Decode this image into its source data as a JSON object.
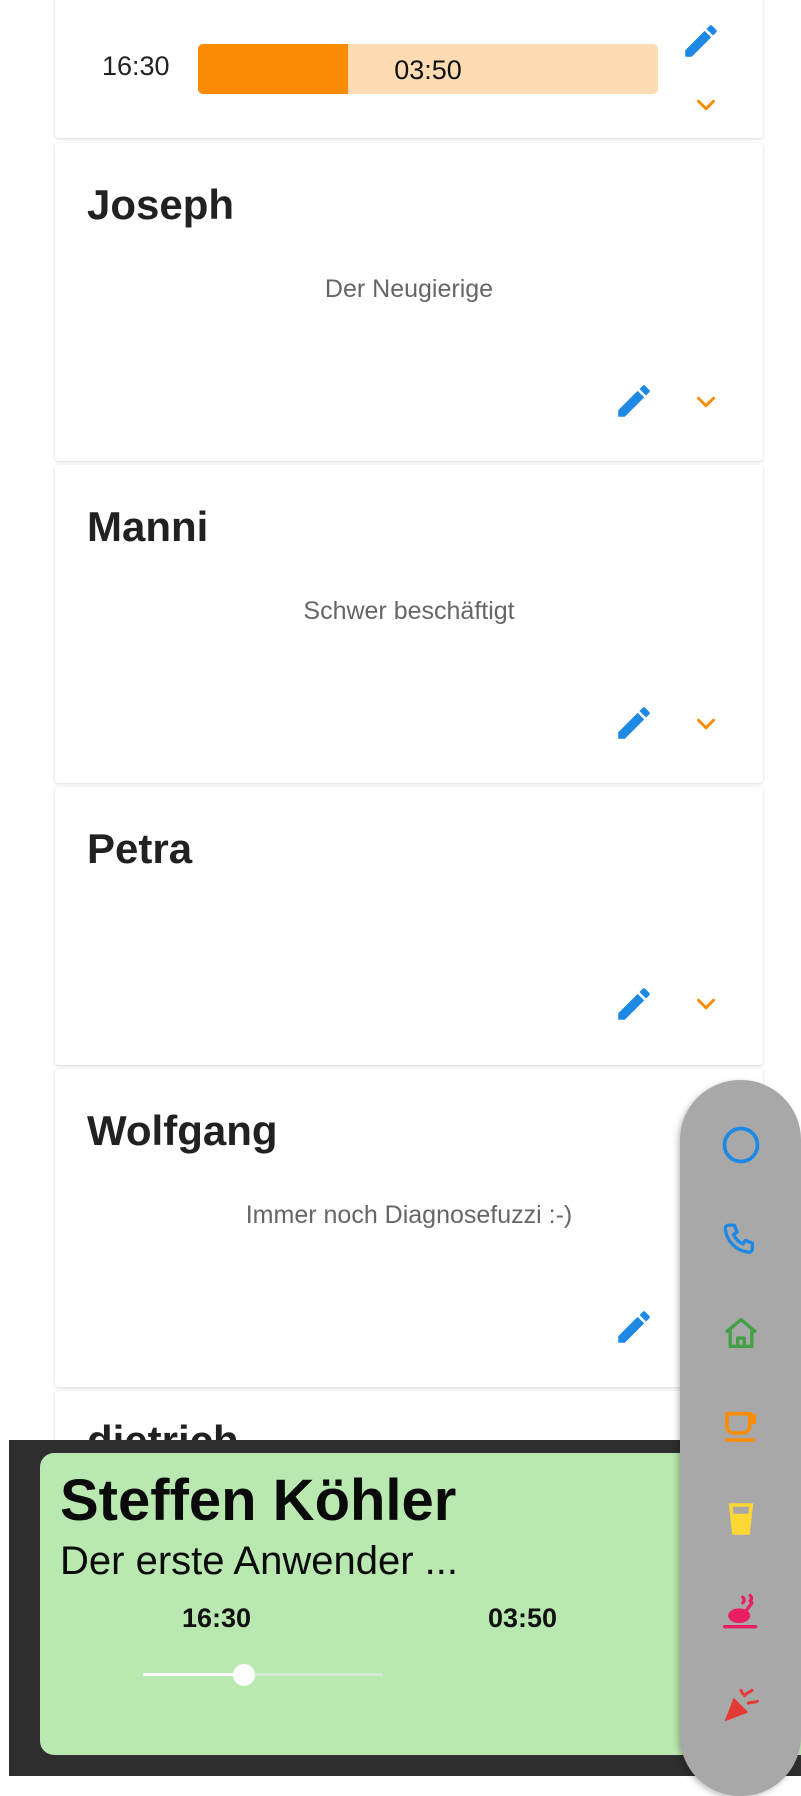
{
  "top_card": {
    "time_left": "16:30",
    "bar_text": "03:50",
    "progress": 0.325
  },
  "cards": [
    {
      "name": "Joseph",
      "status": "Der Neugierige"
    },
    {
      "name": "Manni",
      "status": "Schwer beschäftigt"
    },
    {
      "name": "Petra",
      "status": ""
    },
    {
      "name": "Wolfgang",
      "status": "Immer noch Diagnosefuzzi :-)"
    },
    {
      "name": "dietrich..."
    }
  ],
  "player": {
    "name": "Steffen Köhler",
    "description": "Der erste Anwender ...",
    "time_left": "16:30",
    "time_right": "03:50",
    "slider_value": 0.42
  },
  "fab_actions": [
    {
      "icon": "circle-icon",
      "color": "#1e88e5"
    },
    {
      "icon": "phone-icon",
      "color": "#1e88e5"
    },
    {
      "icon": "home-icon",
      "color": "#43a047"
    },
    {
      "icon": "coffee-icon",
      "color": "#fb8c00"
    },
    {
      "icon": "glass-icon",
      "color": "#fdd835"
    },
    {
      "icon": "food-icon",
      "color": "#e91e63"
    },
    {
      "icon": "party-icon",
      "color": "#e53935"
    }
  ],
  "colors": {
    "accent_blue": "#1e88e5",
    "chevron_orange": "#fb8c00",
    "progress_orange": "#fb8a04",
    "player_green": "#b9e8b0"
  }
}
